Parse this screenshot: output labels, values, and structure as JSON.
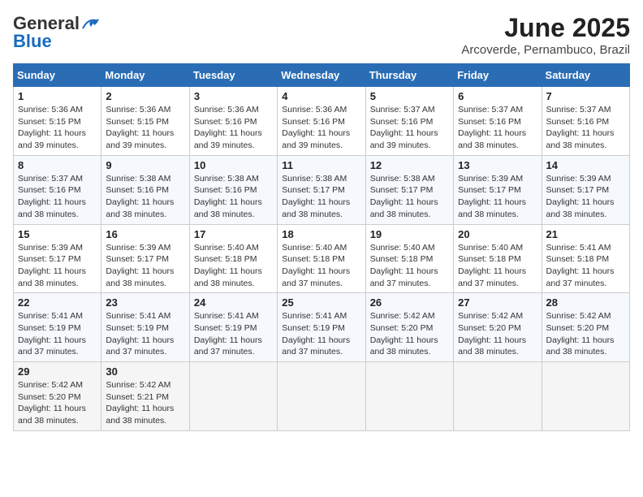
{
  "logo": {
    "general": "General",
    "blue": "Blue"
  },
  "title": "June 2025",
  "subtitle": "Arcoverde, Pernambuco, Brazil",
  "days_of_week": [
    "Sunday",
    "Monday",
    "Tuesday",
    "Wednesday",
    "Thursday",
    "Friday",
    "Saturday"
  ],
  "weeks": [
    [
      {
        "day": "1",
        "info": "Sunrise: 5:36 AM\nSunset: 5:15 PM\nDaylight: 11 hours\nand 39 minutes."
      },
      {
        "day": "2",
        "info": "Sunrise: 5:36 AM\nSunset: 5:15 PM\nDaylight: 11 hours\nand 39 minutes."
      },
      {
        "day": "3",
        "info": "Sunrise: 5:36 AM\nSunset: 5:16 PM\nDaylight: 11 hours\nand 39 minutes."
      },
      {
        "day": "4",
        "info": "Sunrise: 5:36 AM\nSunset: 5:16 PM\nDaylight: 11 hours\nand 39 minutes."
      },
      {
        "day": "5",
        "info": "Sunrise: 5:37 AM\nSunset: 5:16 PM\nDaylight: 11 hours\nand 39 minutes."
      },
      {
        "day": "6",
        "info": "Sunrise: 5:37 AM\nSunset: 5:16 PM\nDaylight: 11 hours\nand 38 minutes."
      },
      {
        "day": "7",
        "info": "Sunrise: 5:37 AM\nSunset: 5:16 PM\nDaylight: 11 hours\nand 38 minutes."
      }
    ],
    [
      {
        "day": "8",
        "info": "Sunrise: 5:37 AM\nSunset: 5:16 PM\nDaylight: 11 hours\nand 38 minutes."
      },
      {
        "day": "9",
        "info": "Sunrise: 5:38 AM\nSunset: 5:16 PM\nDaylight: 11 hours\nand 38 minutes."
      },
      {
        "day": "10",
        "info": "Sunrise: 5:38 AM\nSunset: 5:16 PM\nDaylight: 11 hours\nand 38 minutes."
      },
      {
        "day": "11",
        "info": "Sunrise: 5:38 AM\nSunset: 5:17 PM\nDaylight: 11 hours\nand 38 minutes."
      },
      {
        "day": "12",
        "info": "Sunrise: 5:38 AM\nSunset: 5:17 PM\nDaylight: 11 hours\nand 38 minutes."
      },
      {
        "day": "13",
        "info": "Sunrise: 5:39 AM\nSunset: 5:17 PM\nDaylight: 11 hours\nand 38 minutes."
      },
      {
        "day": "14",
        "info": "Sunrise: 5:39 AM\nSunset: 5:17 PM\nDaylight: 11 hours\nand 38 minutes."
      }
    ],
    [
      {
        "day": "15",
        "info": "Sunrise: 5:39 AM\nSunset: 5:17 PM\nDaylight: 11 hours\nand 38 minutes."
      },
      {
        "day": "16",
        "info": "Sunrise: 5:39 AM\nSunset: 5:17 PM\nDaylight: 11 hours\nand 38 minutes."
      },
      {
        "day": "17",
        "info": "Sunrise: 5:40 AM\nSunset: 5:18 PM\nDaylight: 11 hours\nand 38 minutes."
      },
      {
        "day": "18",
        "info": "Sunrise: 5:40 AM\nSunset: 5:18 PM\nDaylight: 11 hours\nand 37 minutes."
      },
      {
        "day": "19",
        "info": "Sunrise: 5:40 AM\nSunset: 5:18 PM\nDaylight: 11 hours\nand 37 minutes."
      },
      {
        "day": "20",
        "info": "Sunrise: 5:40 AM\nSunset: 5:18 PM\nDaylight: 11 hours\nand 37 minutes."
      },
      {
        "day": "21",
        "info": "Sunrise: 5:41 AM\nSunset: 5:18 PM\nDaylight: 11 hours\nand 37 minutes."
      }
    ],
    [
      {
        "day": "22",
        "info": "Sunrise: 5:41 AM\nSunset: 5:19 PM\nDaylight: 11 hours\nand 37 minutes."
      },
      {
        "day": "23",
        "info": "Sunrise: 5:41 AM\nSunset: 5:19 PM\nDaylight: 11 hours\nand 37 minutes."
      },
      {
        "day": "24",
        "info": "Sunrise: 5:41 AM\nSunset: 5:19 PM\nDaylight: 11 hours\nand 37 minutes."
      },
      {
        "day": "25",
        "info": "Sunrise: 5:41 AM\nSunset: 5:19 PM\nDaylight: 11 hours\nand 37 minutes."
      },
      {
        "day": "26",
        "info": "Sunrise: 5:42 AM\nSunset: 5:20 PM\nDaylight: 11 hours\nand 38 minutes."
      },
      {
        "day": "27",
        "info": "Sunrise: 5:42 AM\nSunset: 5:20 PM\nDaylight: 11 hours\nand 38 minutes."
      },
      {
        "day": "28",
        "info": "Sunrise: 5:42 AM\nSunset: 5:20 PM\nDaylight: 11 hours\nand 38 minutes."
      }
    ],
    [
      {
        "day": "29",
        "info": "Sunrise: 5:42 AM\nSunset: 5:20 PM\nDaylight: 11 hours\nand 38 minutes."
      },
      {
        "day": "30",
        "info": "Sunrise: 5:42 AM\nSunset: 5:21 PM\nDaylight: 11 hours\nand 38 minutes."
      },
      {
        "day": "",
        "info": ""
      },
      {
        "day": "",
        "info": ""
      },
      {
        "day": "",
        "info": ""
      },
      {
        "day": "",
        "info": ""
      },
      {
        "day": "",
        "info": ""
      }
    ]
  ]
}
